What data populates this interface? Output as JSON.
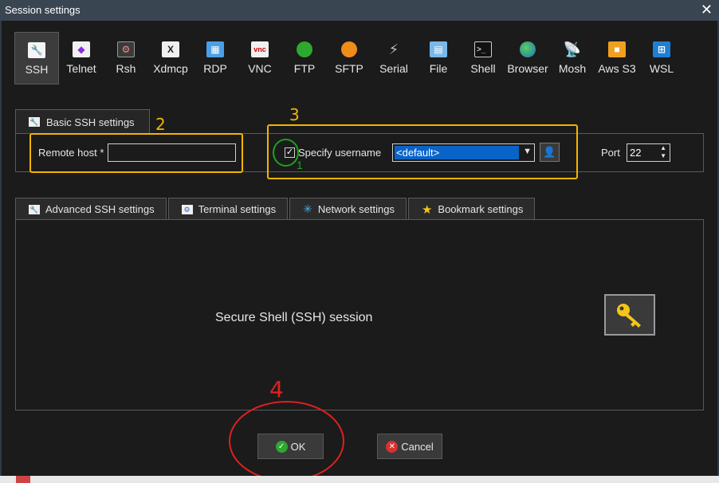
{
  "window": {
    "title": "Session settings",
    "close_icon": "close-icon"
  },
  "protocols": [
    {
      "label": "SSH",
      "icon": "wrench-key-icon",
      "active": true
    },
    {
      "label": "Telnet",
      "icon": "telnet-icon"
    },
    {
      "label": "Rsh",
      "icon": "rsh-icon"
    },
    {
      "label": "Xdmcp",
      "icon": "xdmcp-icon"
    },
    {
      "label": "RDP",
      "icon": "rdp-icon"
    },
    {
      "label": "VNC",
      "icon": "vnc-icon"
    },
    {
      "label": "FTP",
      "icon": "ftp-globe-icon"
    },
    {
      "label": "SFTP",
      "icon": "sftp-globe-icon"
    },
    {
      "label": "Serial",
      "icon": "serial-plug-icon"
    },
    {
      "label": "File",
      "icon": "file-monitor-icon"
    },
    {
      "label": "Shell",
      "icon": "shell-terminal-icon"
    },
    {
      "label": "Browser",
      "icon": "browser-globe-icon"
    },
    {
      "label": "Mosh",
      "icon": "mosh-satellite-icon"
    },
    {
      "label": "Aws S3",
      "icon": "aws-cubes-icon"
    },
    {
      "label": "WSL",
      "icon": "windows-icon"
    }
  ],
  "basic": {
    "tab_label": "Basic SSH settings",
    "remote_host_label": "Remote host *",
    "remote_host_value": "",
    "specify_username_label": "Specify username",
    "specify_username_checked": true,
    "username_value": "<default>",
    "port_label": "Port",
    "port_value": "22"
  },
  "annotations": {
    "n1": "1",
    "n2": "2",
    "n3": "3",
    "n4": "4"
  },
  "tabs": [
    {
      "label": "Advanced SSH settings",
      "icon": "wrench-icon"
    },
    {
      "label": "Terminal settings",
      "icon": "terminal-icon"
    },
    {
      "label": "Network settings",
      "icon": "network-icon"
    },
    {
      "label": "Bookmark settings",
      "icon": "star-icon"
    }
  ],
  "main": {
    "description": "Secure Shell (SSH) session"
  },
  "buttons": {
    "ok": "OK",
    "cancel": "Cancel"
  },
  "colors": {
    "accent": "#0a64c8",
    "annotation_orange": "#f5b400",
    "annotation_green": "#1da11d",
    "annotation_red": "#e02020"
  }
}
